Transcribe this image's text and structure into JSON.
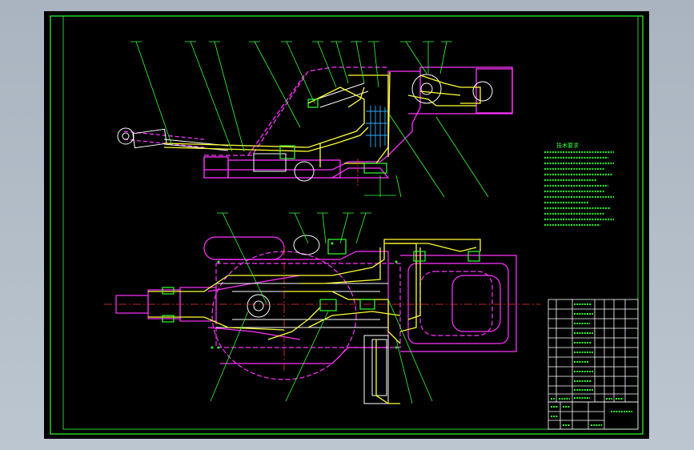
{
  "drawing": {
    "title": "",
    "colors": {
      "background": "#000000",
      "frame": "#33ff33",
      "body": "#ff33ff",
      "hydraulic_lines": "#ffff33",
      "piping": "#ffffff",
      "leaders": "#33ff33",
      "center_lines": "#ff3333",
      "hatch": "#33aaff"
    }
  },
  "views": {
    "elevation": {
      "label": ""
    },
    "plan": {
      "label": ""
    }
  },
  "tech_notes": {
    "heading": "技术要求"
  },
  "title_block": {
    "name": ""
  }
}
